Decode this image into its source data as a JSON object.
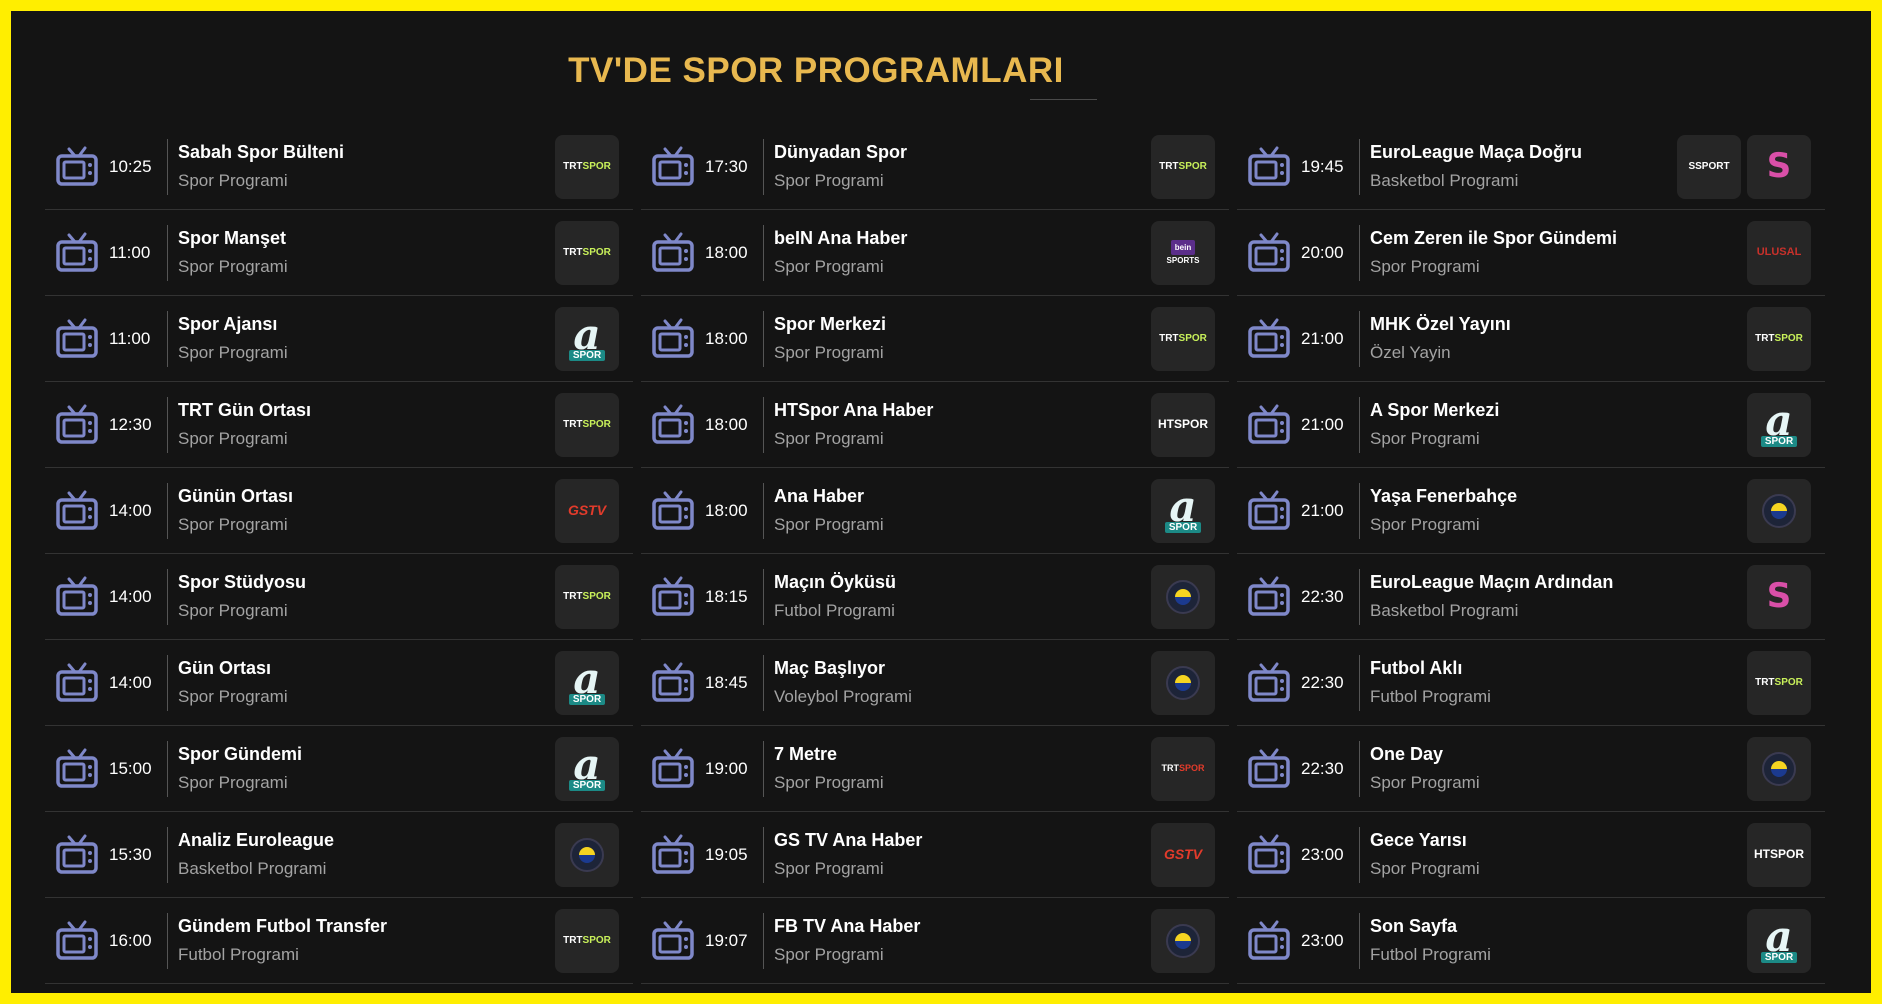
{
  "page": {
    "title": "TV'DE SPOR PROGRAMLARI"
  },
  "colors": {
    "accent": "#e8b84f",
    "border": "#ffee00",
    "background": "#141414",
    "icon": "#7f88c9"
  },
  "columns": [
    [
      {
        "time": "10:25",
        "name": "Sabah Spor Bülteni",
        "type": "Spor Programi",
        "logos": [
          {
            "kind": "trt",
            "text": "TRT",
            "text2": "SPOR"
          }
        ]
      },
      {
        "time": "11:00",
        "name": "Spor Manşet",
        "type": "Spor Programi",
        "logos": [
          {
            "kind": "trt",
            "text": "TRT",
            "text2": "SPOR"
          }
        ]
      },
      {
        "time": "11:00",
        "name": "Spor Ajansı",
        "type": "Spor Programi",
        "logos": [
          {
            "kind": "aspor",
            "text": "a",
            "text2": "SPOR"
          }
        ]
      },
      {
        "time": "12:30",
        "name": "TRT Gün Ortası",
        "type": "Spor Programi",
        "logos": [
          {
            "kind": "trt",
            "text": "TRT",
            "text2": "SPOR"
          }
        ]
      },
      {
        "time": "14:00",
        "name": "Günün Ortası",
        "type": "Spor Programi",
        "logos": [
          {
            "kind": "gstv",
            "text": "GS",
            "text2": "TV"
          }
        ]
      },
      {
        "time": "14:00",
        "name": "Spor Stüdyosu",
        "type": "Spor Programi",
        "logos": [
          {
            "kind": "trt",
            "text": "TRT",
            "text2": "SPOR"
          }
        ]
      },
      {
        "time": "14:00",
        "name": "Gün Ortası",
        "type": "Spor Programi",
        "logos": [
          {
            "kind": "aspor",
            "text": "a",
            "text2": "SPOR"
          }
        ]
      },
      {
        "time": "15:00",
        "name": "Spor Gündemi",
        "type": "Spor Programi",
        "logos": [
          {
            "kind": "aspor",
            "text": "a",
            "text2": "SPOR"
          }
        ]
      },
      {
        "time": "15:30",
        "name": "Analiz Euroleague",
        "type": "Basketbol Programi",
        "logos": [
          {
            "kind": "fb",
            "text": "",
            "text2": ""
          }
        ]
      },
      {
        "time": "16:00",
        "name": "Gündem Futbol Transfer",
        "type": "Futbol Programi",
        "logos": [
          {
            "kind": "trt",
            "text": "TRT",
            "text2": "SPOR"
          }
        ]
      }
    ],
    [
      {
        "time": "17:30",
        "name": "Dünyadan Spor",
        "type": "Spor Programi",
        "logos": [
          {
            "kind": "trt",
            "text": "TRT",
            "text2": "SPOR"
          }
        ]
      },
      {
        "time": "18:00",
        "name": "beIN Ana Haber",
        "type": "Spor Programi",
        "logos": [
          {
            "kind": "bein",
            "text": "bein",
            "text2": "SPORTS"
          }
        ]
      },
      {
        "time": "18:00",
        "name": "Spor Merkezi",
        "type": "Spor Programi",
        "logos": [
          {
            "kind": "trt",
            "text": "TRT",
            "text2": "SPOR"
          }
        ]
      },
      {
        "time": "18:00",
        "name": "HTSpor Ana Haber",
        "type": "Spor Programi",
        "logos": [
          {
            "kind": "ht",
            "text": "HT",
            "text2": "SPOR"
          }
        ]
      },
      {
        "time": "18:00",
        "name": "Ana Haber",
        "type": "Spor Programi",
        "logos": [
          {
            "kind": "aspor",
            "text": "a",
            "text2": "SPOR"
          }
        ]
      },
      {
        "time": "18:15",
        "name": "Maçın Öyküsü",
        "type": "Futbol Programi",
        "logos": [
          {
            "kind": "fb",
            "text": "",
            "text2": ""
          }
        ]
      },
      {
        "time": "18:45",
        "name": "Maç Başlıyor",
        "type": "Voleybol Programi",
        "logos": [
          {
            "kind": "fb",
            "text": "",
            "text2": ""
          }
        ]
      },
      {
        "time": "19:00",
        "name": "7 Metre",
        "type": "Spor Programi",
        "logos": [
          {
            "kind": "trtstar",
            "text": "TRT",
            "text2": "SPOR"
          }
        ]
      },
      {
        "time": "19:05",
        "name": "GS TV Ana Haber",
        "type": "Spor Programi",
        "logos": [
          {
            "kind": "gstv",
            "text": "GS",
            "text2": "TV"
          }
        ]
      },
      {
        "time": "19:07",
        "name": "FB TV Ana Haber",
        "type": "Spor Programi",
        "logos": [
          {
            "kind": "fb",
            "text": "",
            "text2": ""
          }
        ]
      }
    ],
    [
      {
        "time": "19:45",
        "name": "EuroLeague Maça Doğru",
        "type": "Basketbol Programi",
        "logos": [
          {
            "kind": "ssport",
            "text": "S",
            "text2": "SPORT"
          },
          {
            "kind": "splus",
            "text": "S",
            "text2": ""
          }
        ]
      },
      {
        "time": "20:00",
        "name": "Cem Zeren ile Spor Gündemi",
        "type": "Spor Programi",
        "logos": [
          {
            "kind": "ulusal",
            "text": "ULUSAL",
            "text2": ""
          }
        ]
      },
      {
        "time": "21:00",
        "name": "MHK Özel Yayını",
        "type": "Özel Yayin",
        "logos": [
          {
            "kind": "trt",
            "text": "TRT",
            "text2": "SPOR"
          }
        ]
      },
      {
        "time": "21:00",
        "name": "A Spor Merkezi",
        "type": "Spor Programi",
        "logos": [
          {
            "kind": "aspor",
            "text": "a",
            "text2": "SPOR"
          }
        ]
      },
      {
        "time": "21:00",
        "name": "Yaşa Fenerbahçe",
        "type": "Spor Programi",
        "logos": [
          {
            "kind": "fb",
            "text": "",
            "text2": ""
          }
        ]
      },
      {
        "time": "22:30",
        "name": "EuroLeague Maçın Ardından",
        "type": "Basketbol Programi",
        "logos": [
          {
            "kind": "splus",
            "text": "S",
            "text2": ""
          }
        ]
      },
      {
        "time": "22:30",
        "name": "Futbol Aklı",
        "type": "Futbol Programi",
        "logos": [
          {
            "kind": "trt",
            "text": "TRT",
            "text2": "SPOR"
          }
        ]
      },
      {
        "time": "22:30",
        "name": "One Day",
        "type": "Spor Programi",
        "logos": [
          {
            "kind": "fb",
            "text": "",
            "text2": ""
          }
        ]
      },
      {
        "time": "23:00",
        "name": "Gece Yarısı",
        "type": "Spor Programi",
        "logos": [
          {
            "kind": "ht",
            "text": "HT",
            "text2": "SPOR"
          }
        ]
      },
      {
        "time": "23:00",
        "name": "Son Sayfa",
        "type": "Futbol Programi",
        "logos": [
          {
            "kind": "aspor",
            "text": "a",
            "text2": "SPOR"
          }
        ]
      }
    ]
  ]
}
